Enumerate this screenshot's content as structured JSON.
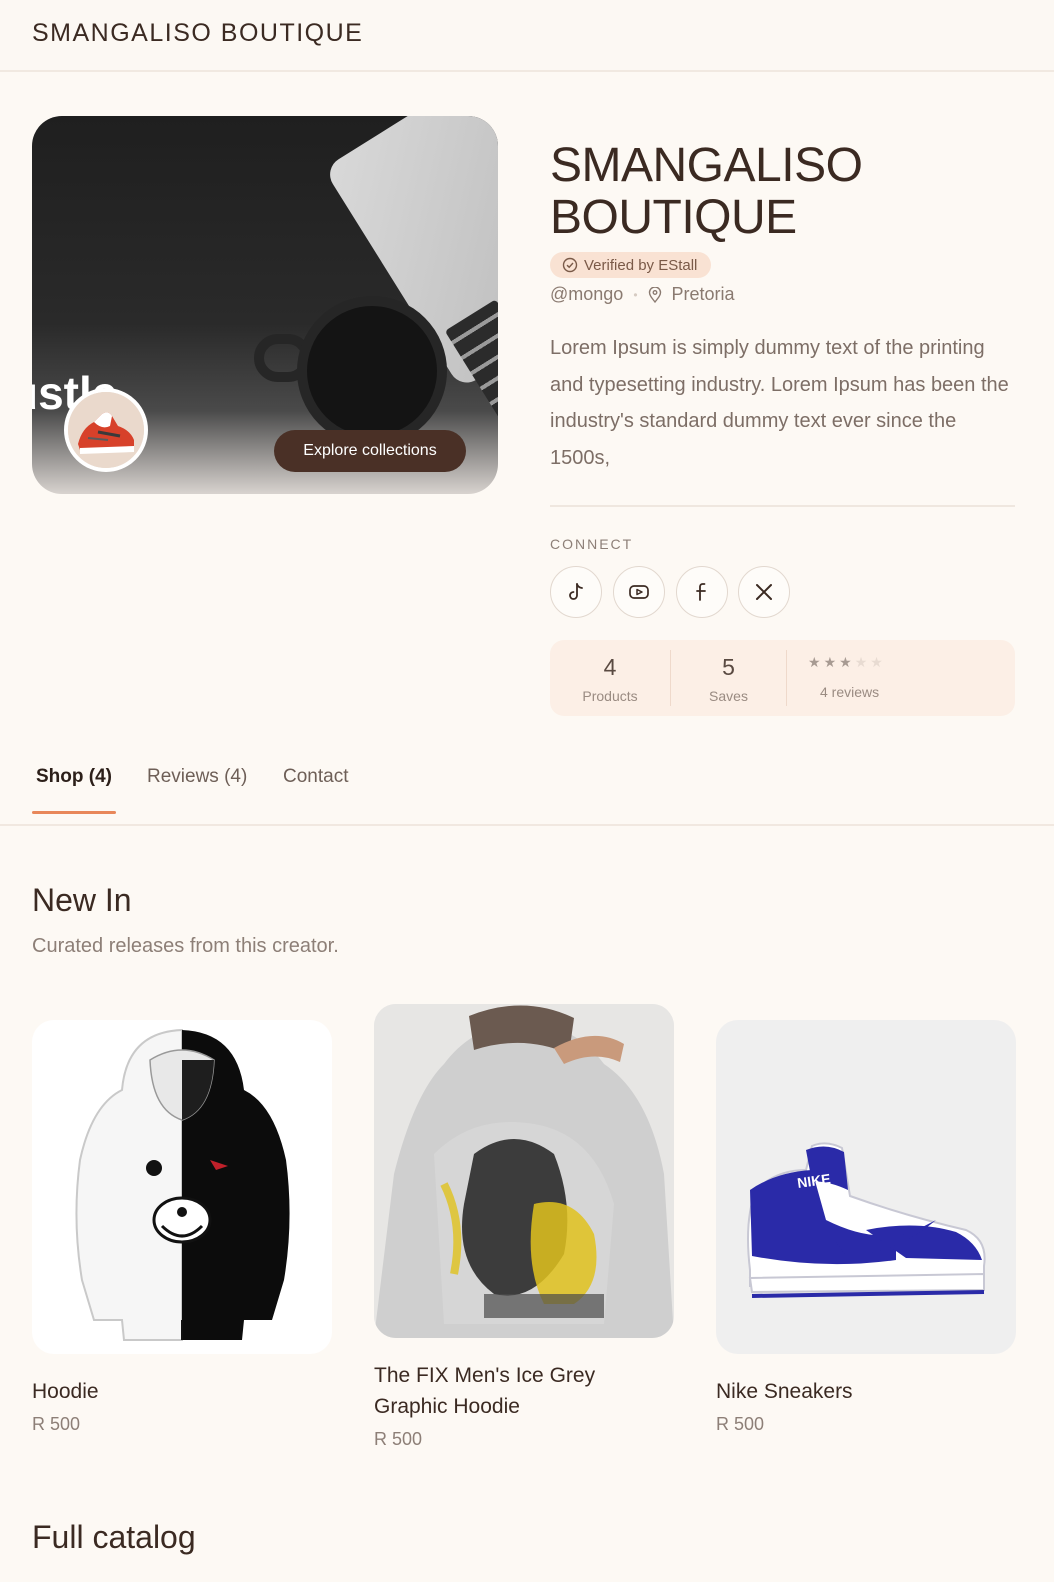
{
  "header": {
    "brand": "SMANGALISO BOUTIQUE"
  },
  "hero": {
    "slogan": "ustle.",
    "explore_label": "Explore collections"
  },
  "store": {
    "title_line1": "SMANGALISO",
    "title_line2": "BOUTIQUE",
    "verified_label": "Verified by EStall",
    "handle": "@mongo",
    "location": "Pretoria",
    "description": "Lorem Ipsum is simply dummy text of the printing and typesetting industry. Lorem Ipsum has been the industry's standard dummy text ever since the 1500s,"
  },
  "connect": {
    "label": "CONNECT",
    "icons": [
      "tiktok-icon",
      "youtube-icon",
      "facebook-icon",
      "x-icon"
    ]
  },
  "stats": {
    "products_count": "4",
    "products_label": "Products",
    "saves_count": "5",
    "saves_label": "Saves",
    "rating": 3,
    "rating_max": 5,
    "reviews_label": "4 reviews"
  },
  "tabs": [
    {
      "label": "Shop (4)",
      "active": true
    },
    {
      "label": "Reviews (4)",
      "active": false
    },
    {
      "label": "Contact",
      "active": false
    }
  ],
  "new_in": {
    "title": "New In",
    "subtitle": "Curated releases from this creator.",
    "products": [
      {
        "name": "Hoodie",
        "price": "R 500"
      },
      {
        "name": "The FIX Men's Ice Grey Graphic Hoodie",
        "price": "R 500"
      },
      {
        "name": "Nike Sneakers",
        "price": "R 500"
      }
    ]
  },
  "full_catalog": {
    "title": "Full catalog"
  },
  "colors": {
    "background": "#fdf9f4",
    "accent": "#e8875a",
    "button_dark": "#4a3026",
    "verified_bg": "#f9e2d3",
    "stats_bg": "#fcefe6"
  }
}
